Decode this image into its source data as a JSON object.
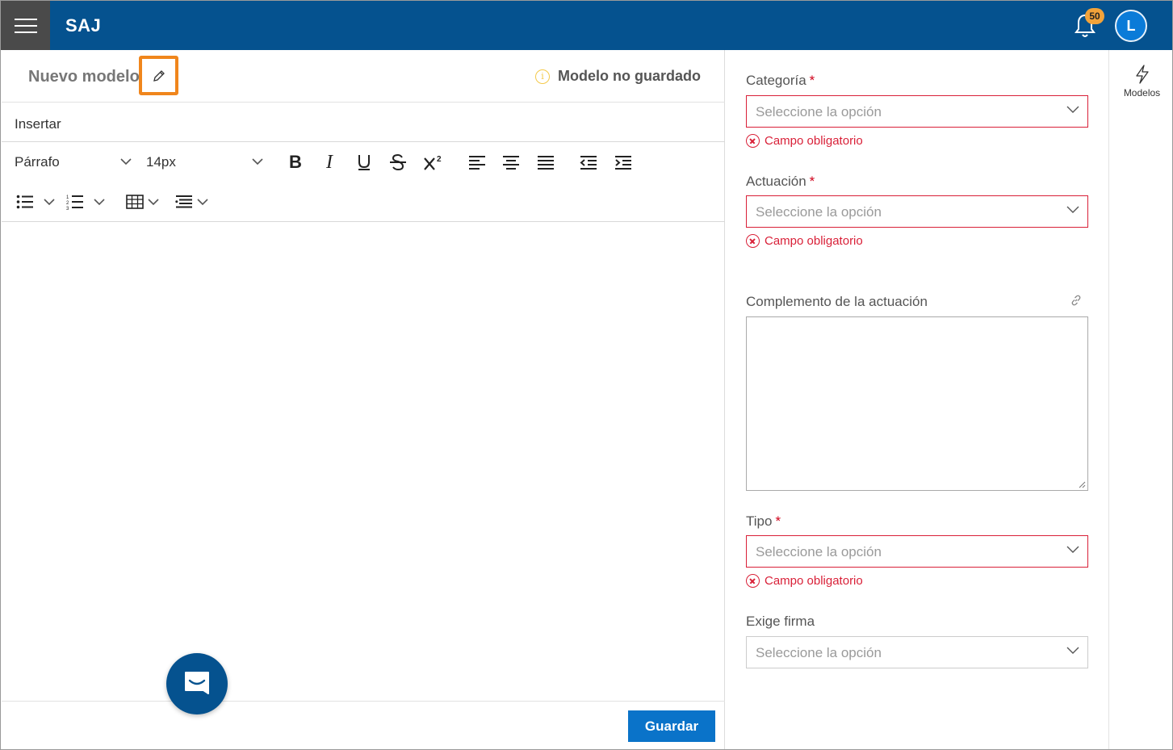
{
  "header": {
    "brand": "SAJ",
    "notifications_count": "50",
    "avatar_initial": "L"
  },
  "editor": {
    "title": "Nuevo modelo",
    "status": "Modelo no guardado",
    "menu": {
      "insert": "Insertar"
    },
    "toolbar": {
      "paragraph": "Párrafo",
      "font_size": "14px"
    },
    "save_label": "Guardar"
  },
  "form": {
    "categoria": {
      "label": "Categoría",
      "placeholder": "Seleccione la opción",
      "error": "Campo obligatorio",
      "required": "*"
    },
    "actuacion": {
      "label": "Actuación",
      "placeholder": "Seleccione la opción",
      "error": "Campo obligatorio",
      "required": "*"
    },
    "complemento": {
      "label": "Complemento de la actuación"
    },
    "tipo": {
      "label": "Tipo",
      "placeholder": "Seleccione la opción",
      "error": "Campo obligatorio",
      "required": "*"
    },
    "exige_firma": {
      "label": "Exige firma",
      "placeholder": "Seleccione la opción"
    }
  },
  "rail": {
    "models_label": "Modelos"
  },
  "colors": {
    "topbar": "#05528f",
    "accent": "#0a73c9",
    "error": "#d92038",
    "highlight": "#f0861c"
  }
}
